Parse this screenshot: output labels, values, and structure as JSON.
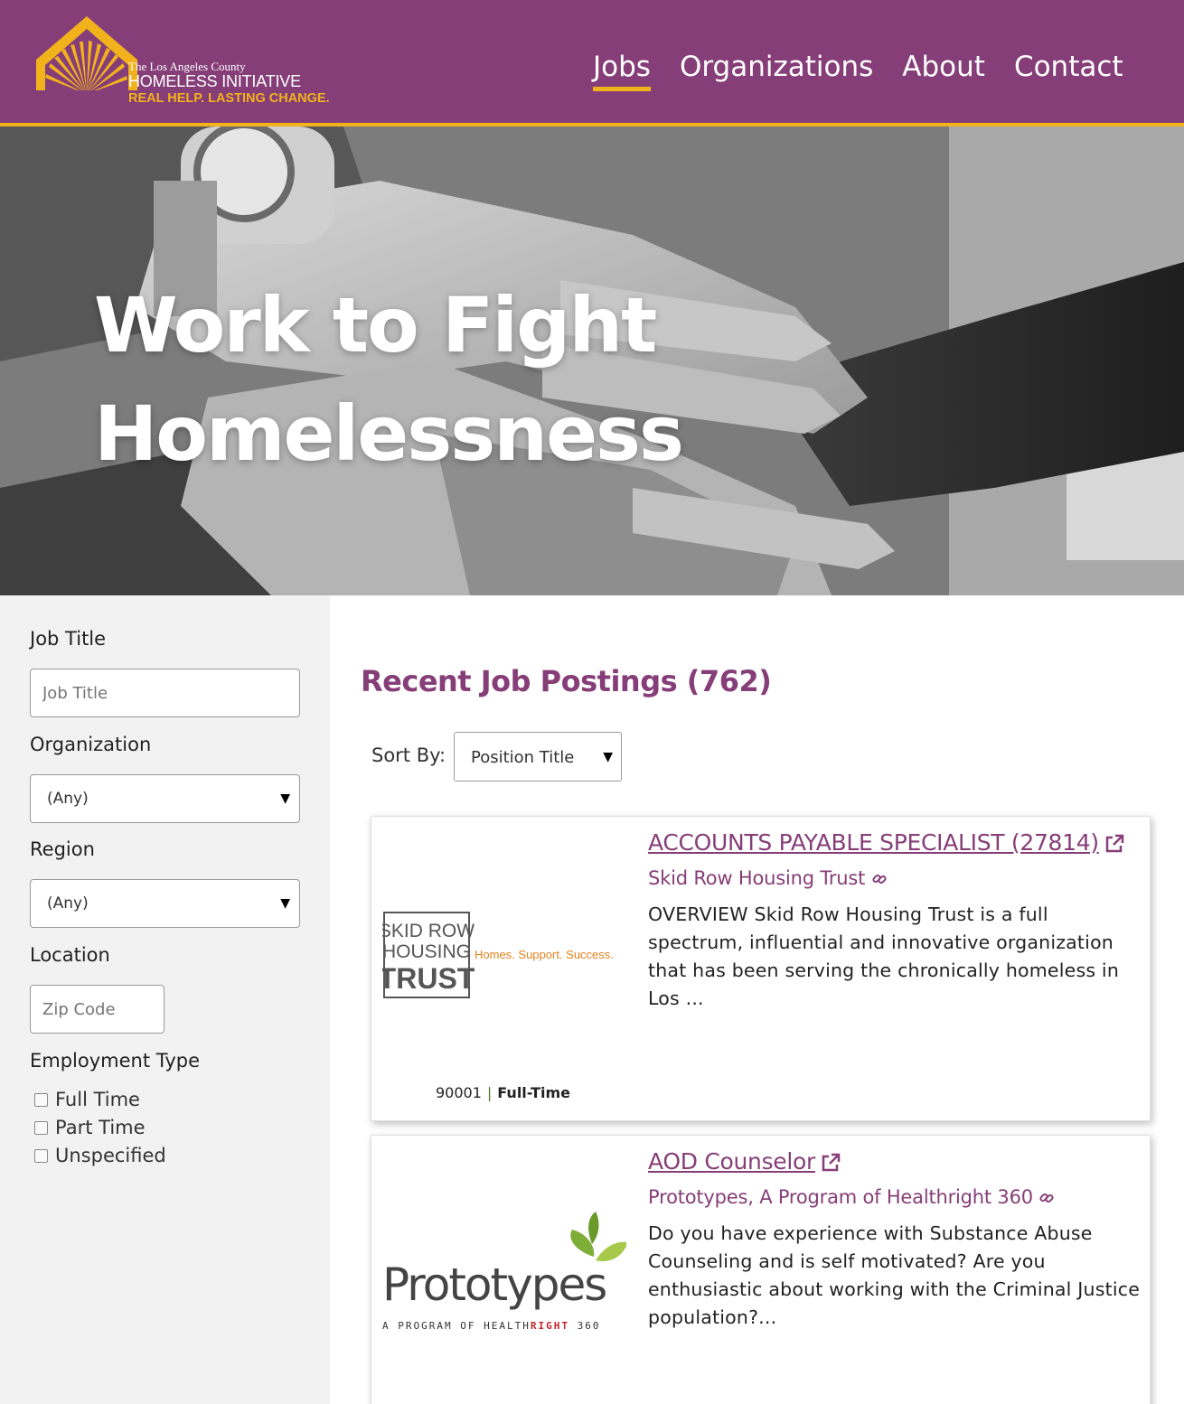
{
  "header": {
    "logo": {
      "line1": "The Los Angeles County",
      "line2": "HOMELESS INITIATIVE",
      "line3": "REAL HELP. LASTING CHANGE."
    },
    "nav": [
      {
        "label": "Jobs",
        "active": true
      },
      {
        "label": "Organizations",
        "active": false
      },
      {
        "label": "About",
        "active": false
      },
      {
        "label": "Contact",
        "active": false
      }
    ]
  },
  "hero": {
    "title_line1": "Work to Fight",
    "title_line2": "Homelessness"
  },
  "filters": {
    "job_title": {
      "label": "Job Title",
      "placeholder": "Job Title"
    },
    "organization": {
      "label": "Organization",
      "selected": "(Any)"
    },
    "region": {
      "label": "Region",
      "selected": "(Any)"
    },
    "location": {
      "label": "Location",
      "placeholder": "Zip Code"
    },
    "employment_type": {
      "label": "Employment Type",
      "options": [
        "Full Time",
        "Part Time",
        "Unspecified"
      ]
    }
  },
  "results": {
    "title": "Recent Job Postings (762)",
    "sort_label": "Sort By:",
    "sort_selected": "Position Title",
    "jobs": [
      {
        "title": "ACCOUNTS PAYABLE SPECIALIST (27814)",
        "organization": "Skid Row Housing Trust",
        "description": "OVERVIEW   Skid Row Housing Trust is a full spectrum, influential and innovative organization that has been serving the chronically homeless in Los ...",
        "zip": "90001",
        "type": "Full-Time",
        "logo": {
          "line1": "SKID ROW",
          "line2": "HOUSING",
          "line3": "TRUST",
          "tagline": "Homes. Support. Success."
        }
      },
      {
        "title": "AOD Counselor",
        "organization": "Prototypes, A Program of Healthright 360",
        "description": "Do you have experience with Substance Abuse Counseling and is self motivated? Are you enthusiastic about working with the Criminal Justice population?...",
        "logo": {
          "name": "Prototypes",
          "sub": "A PROGRAM OF HEALTH",
          "sub_highlight": "RIGHT",
          "sub_end": " 360"
        }
      }
    ]
  },
  "colors": {
    "brand_purple": "#863e78",
    "brand_gold": "#f2b21c"
  }
}
